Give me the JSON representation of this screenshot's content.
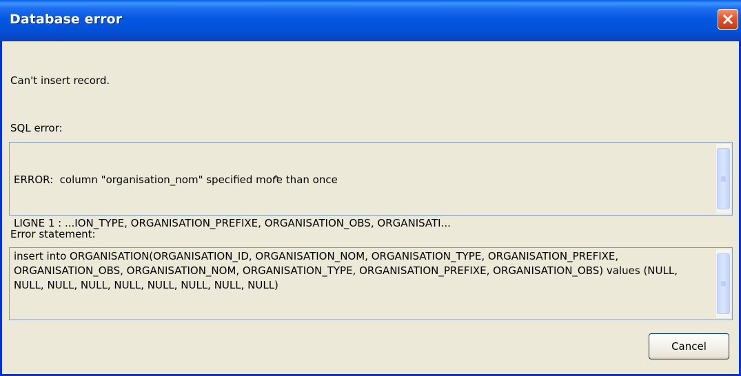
{
  "window": {
    "title": "Database error",
    "close_icon": "close-x-icon"
  },
  "message": "Can't insert record.",
  "sql_error": {
    "label": "SQL error:",
    "lines": [
      "ERROR:  column \"organisation_nom\" specified more than once",
      "LIGNE 1 : ...ION_TYPE, ORGANISATION_PREFIXE, ORGANISATION_OBS, ORGANISATI...",
      "^"
    ]
  },
  "error_statement": {
    "label": "Error statement:",
    "text": "insert into ORGANISATION(ORGANISATION_ID, ORGANISATION_NOM, ORGANISATION_TYPE, ORGANISATION_PREFIXE, ORGANISATION_OBS, ORGANISATION_NOM, ORGANISATION_TYPE, ORGANISATION_PREFIXE, ORGANISATION_OBS) values (NULL, NULL, NULL, NULL, NULL, NULL, NULL, NULL, NULL)"
  },
  "buttons": {
    "cancel_label": "Cancel"
  },
  "colors": {
    "titlebar": "#0557e0",
    "window_bg": "#ece9d8",
    "close_button": "#e3542f",
    "border": "#7f9db9"
  }
}
